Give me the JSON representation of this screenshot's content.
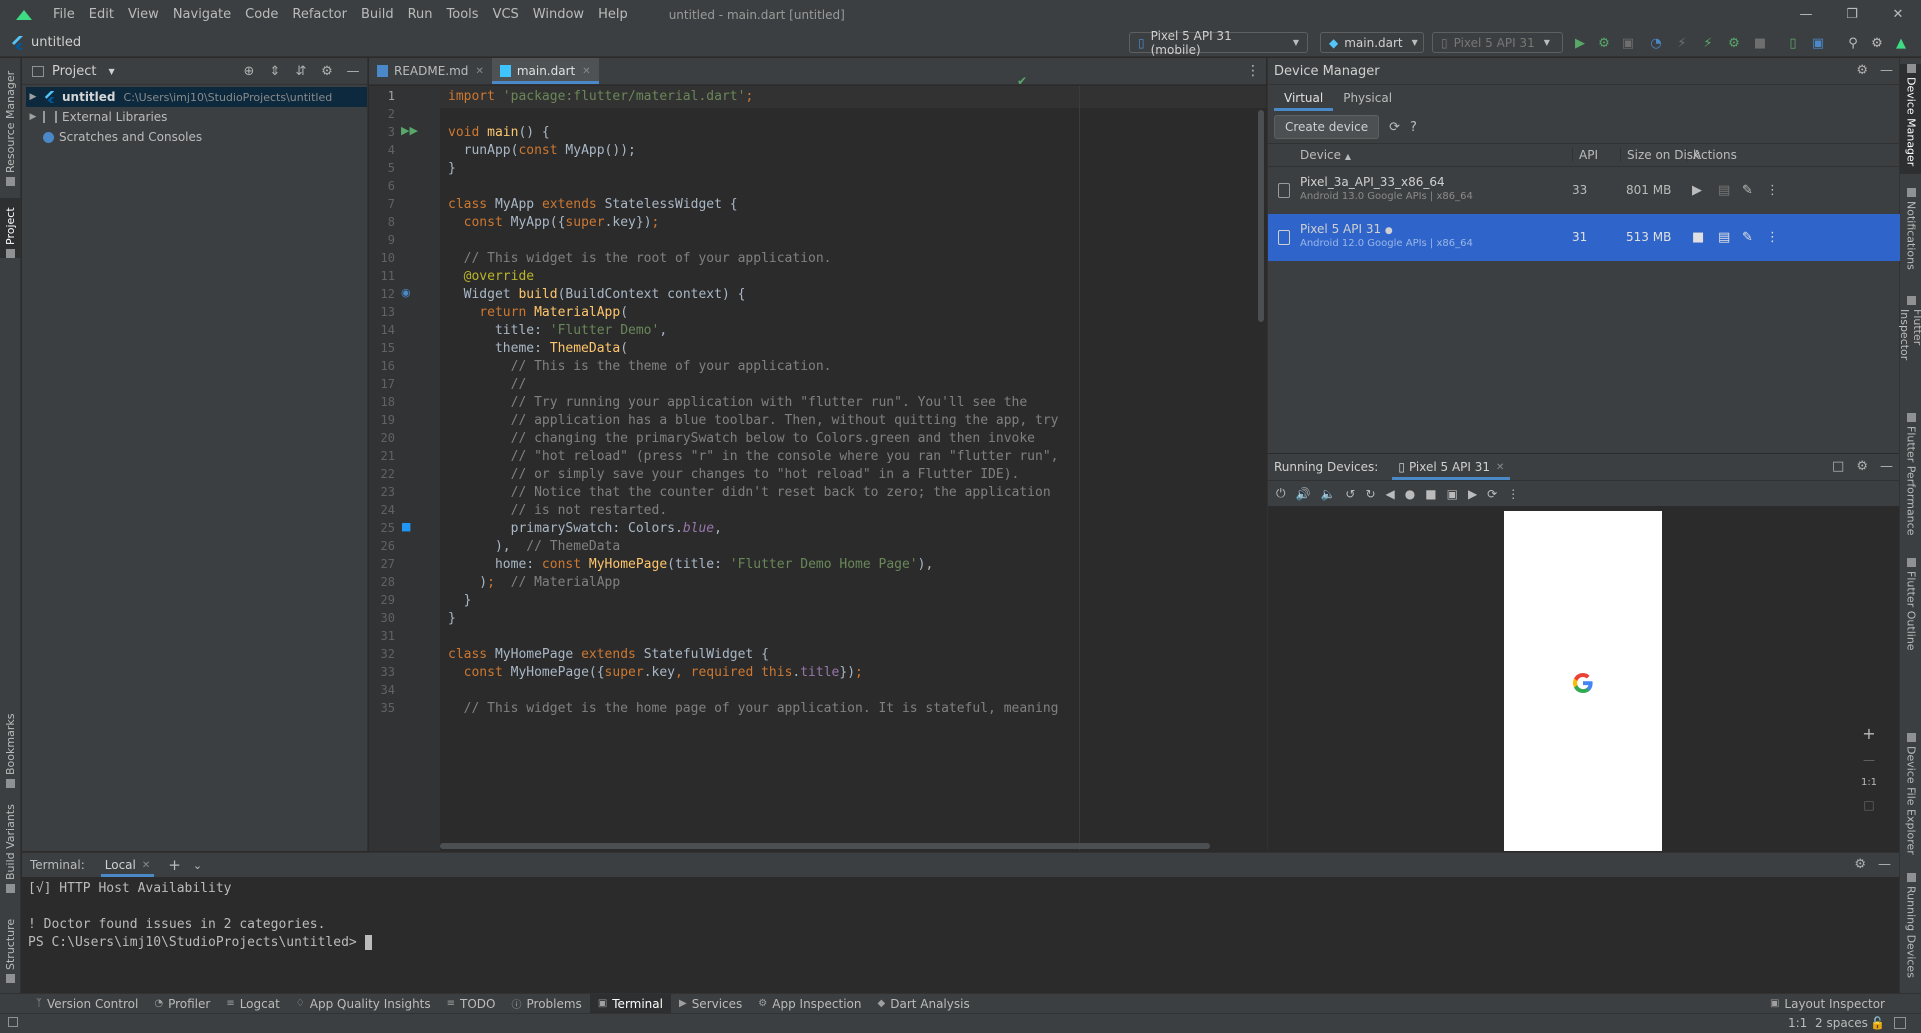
{
  "window": {
    "title": "untitled - main.dart [untitled]",
    "menu": [
      "File",
      "Edit",
      "View",
      "Navigate",
      "Code",
      "Refactor",
      "Build",
      "Run",
      "Tools",
      "VCS",
      "Window",
      "Help"
    ]
  },
  "navbar": {
    "project_name": "untitled",
    "device_selector": "Pixel 5 API 31 (mobile)",
    "run_config": "main.dart",
    "target_device": "Pixel 5 API 31"
  },
  "left_strip": [
    "Resource Manager",
    "Project",
    "Bookmarks",
    "Build Variants",
    "Structure"
  ],
  "right_strip": [
    "Device Manager",
    "Notifications",
    "Flutter Inspector",
    "Flutter Performance",
    "Flutter Outline",
    "Device File Explorer",
    "Running Devices"
  ],
  "project_panel": {
    "title": "Project",
    "tree": [
      {
        "label": "untitled",
        "path": "C:\\Users\\imj10\\StudioProjects\\untitled"
      },
      {
        "label": "External Libraries"
      },
      {
        "label": "Scratches and Consoles"
      }
    ]
  },
  "editor": {
    "tabs": [
      {
        "label": "README.md"
      },
      {
        "label": "main.dart"
      }
    ],
    "line_numbers": [
      "1",
      "2",
      "3",
      "4",
      "5",
      "6",
      "7",
      "8",
      "9",
      "10",
      "11",
      "12",
      "13",
      "14",
      "15",
      "16",
      "17",
      "18",
      "19",
      "20",
      "21",
      "22",
      "23",
      "24",
      "25",
      "26",
      "27",
      "28",
      "29",
      "30",
      "31",
      "32",
      "33",
      "34",
      "35"
    ]
  },
  "device_manager": {
    "title": "Device Manager",
    "tabs": [
      "Virtual",
      "Physical"
    ],
    "create_button": "Create device",
    "help": "?",
    "columns": {
      "device": "Device",
      "api": "API",
      "size": "Size on Disk",
      "actions": "Actions"
    },
    "devices": [
      {
        "name": "Pixel_3a_API_33_x86_64",
        "sub": "Android 13.0 Google APIs | x86_64",
        "api": "33",
        "size": "801 MB"
      },
      {
        "name": "Pixel 5 API 31",
        "sub": "Android 12.0 Google APIs | x86_64",
        "api": "31",
        "size": "513 MB"
      }
    ]
  },
  "running_devices": {
    "label": "Running Devices:",
    "tab": "Pixel 5 API 31",
    "zoom_ratio": "1:1"
  },
  "terminal": {
    "title": "Terminal:",
    "tab": "Local",
    "lines": [
      "[√] HTTP Host Availability",
      "",
      "! Doctor found issues in 2 categories.",
      "PS C:\\Users\\imj10\\StudioProjects\\untitled> "
    ]
  },
  "bottom_tools": [
    "Version Control",
    "Profiler",
    "Logcat",
    "App Quality Insights",
    "TODO",
    "Problems",
    "Terminal",
    "Services",
    "App Inspection",
    "Dart Analysis"
  ],
  "layout_inspector": "Layout Inspector",
  "status": {
    "position": "1:1",
    "indent": "2 spaces"
  },
  "colors": {
    "accent": "#4a88c7",
    "selection": "#2f65ca",
    "run_green": "#59a869"
  }
}
